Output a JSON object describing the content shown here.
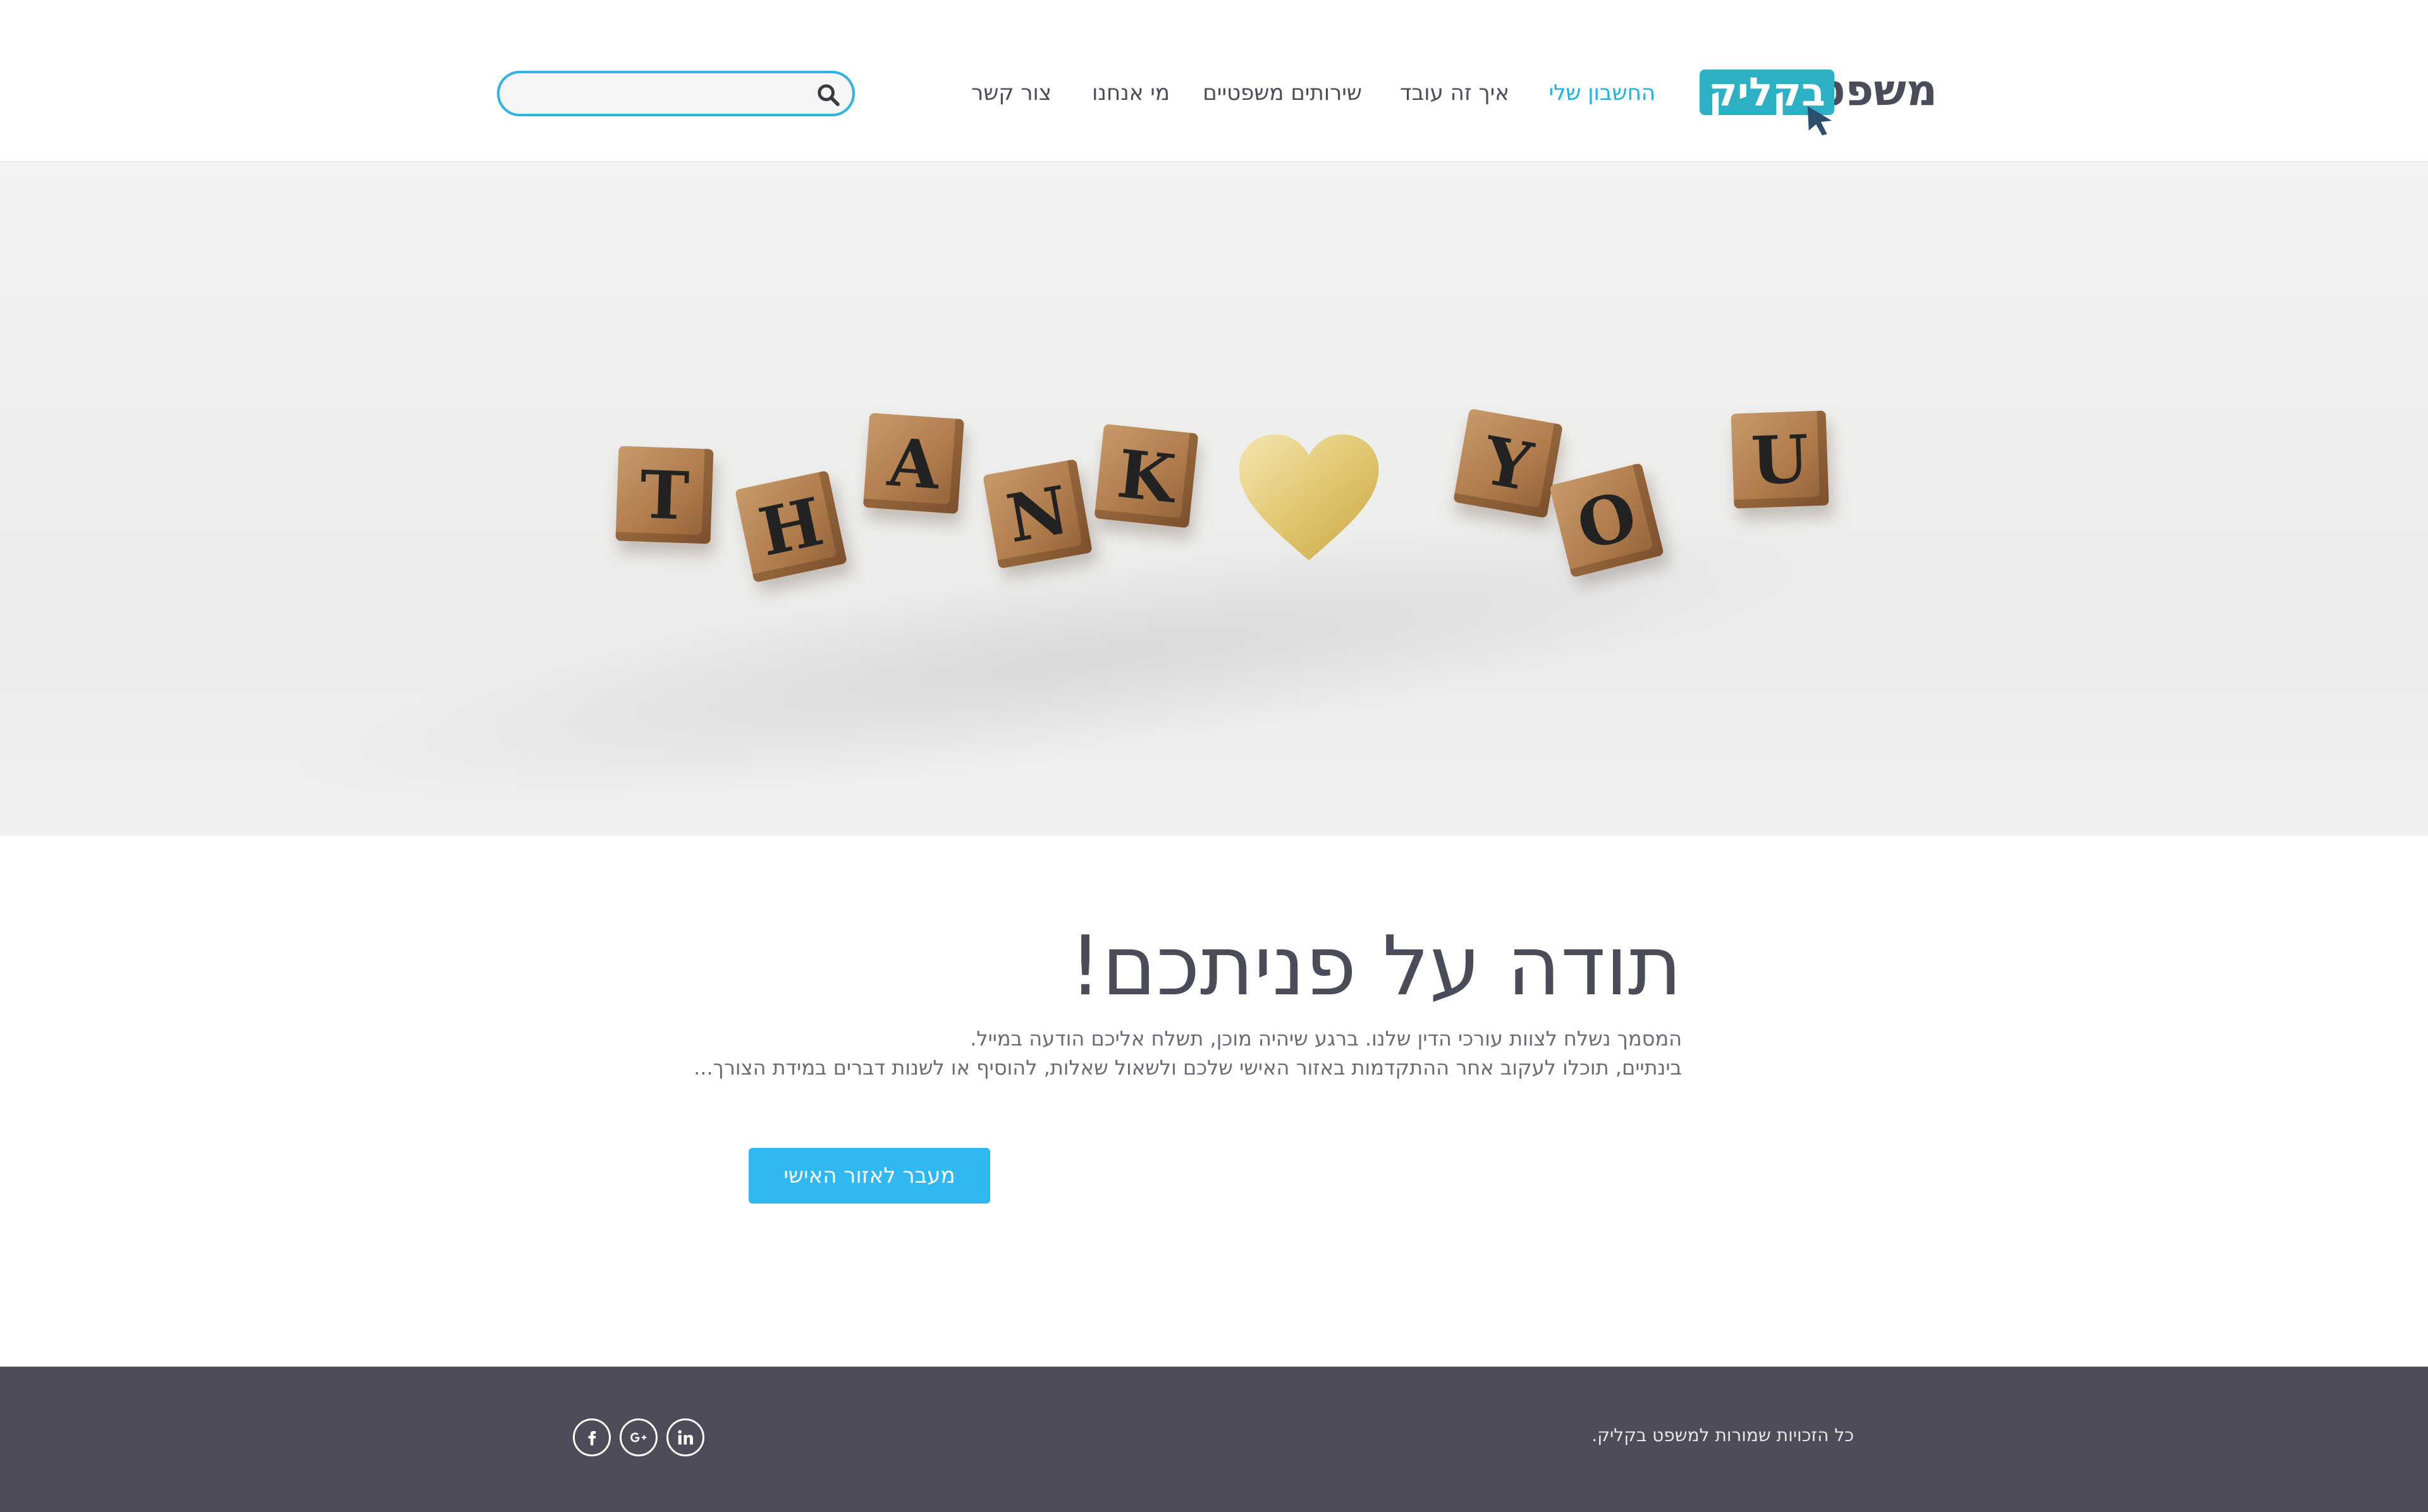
{
  "header": {
    "logo": {
      "word1": "משפט",
      "word2": "בקליק"
    },
    "nav": [
      {
        "label": "החשבון שלי",
        "active": true
      },
      {
        "label": "איך זה עובד",
        "active": false
      },
      {
        "label": "שירותים משפטיים",
        "active": false
      },
      {
        "label": "מי אנחנו",
        "active": false
      },
      {
        "label": "צור קשר",
        "active": false
      }
    ],
    "search": {
      "placeholder": "",
      "icon": "search-icon"
    }
  },
  "hero": {
    "blocks_left": [
      "T",
      "H",
      "A",
      "N",
      "K"
    ],
    "blocks_right": [
      "Y",
      "O",
      "U"
    ],
    "heart": "heart"
  },
  "main": {
    "title": "תודה על פניתכם!",
    "line1": "המסמך נשלח לצוות עורכי הדין שלנו. ברגע שיהיה מוכן, תשלח אליכם הודעה במייל.",
    "line2": "בינתיים, תוכלו לעקוב אחר ההתקדמות באזור האישי שלכם ולשאול שאלות, להוסיף או לשנות דברים במידת הצורך...",
    "cta_label": "מעבר לאזור האישי"
  },
  "footer": {
    "copyright": "כל הזכויות שמורות למשפט בקליק.",
    "social": [
      "linkedin-icon",
      "google-plus-icon",
      "facebook-icon"
    ]
  },
  "colors": {
    "accent": "#1ab1e6",
    "logo_box": "#2cb0c3",
    "cta": "#2fb9f0",
    "footer_bg": "#4d4c58",
    "text": "#4b4c5a"
  }
}
